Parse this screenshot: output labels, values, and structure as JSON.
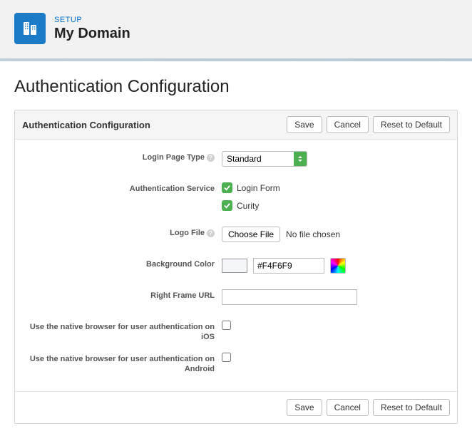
{
  "header": {
    "setup_label": "SETUP",
    "page_title": "My Domain"
  },
  "page": {
    "heading": "Authentication Configuration"
  },
  "panel": {
    "title": "Authentication Configuration",
    "buttons": {
      "save": "Save",
      "cancel": "Cancel",
      "reset": "Reset to Default"
    },
    "fields": {
      "login_page_type": {
        "label": "Login Page Type",
        "value": "Standard"
      },
      "auth_service": {
        "label": "Authentication Service",
        "options": [
          "Login Form",
          "Curity"
        ]
      },
      "logo_file": {
        "label": "Logo File",
        "button": "Choose File",
        "status": "No file chosen"
      },
      "bg_color": {
        "label": "Background Color",
        "value": "#F4F6F9"
      },
      "right_frame_url": {
        "label": "Right Frame URL",
        "value": ""
      },
      "native_ios": {
        "label": "Use the native browser for user authentication on iOS"
      },
      "native_android": {
        "label": "Use the native browser for user authentication on Android"
      }
    }
  }
}
